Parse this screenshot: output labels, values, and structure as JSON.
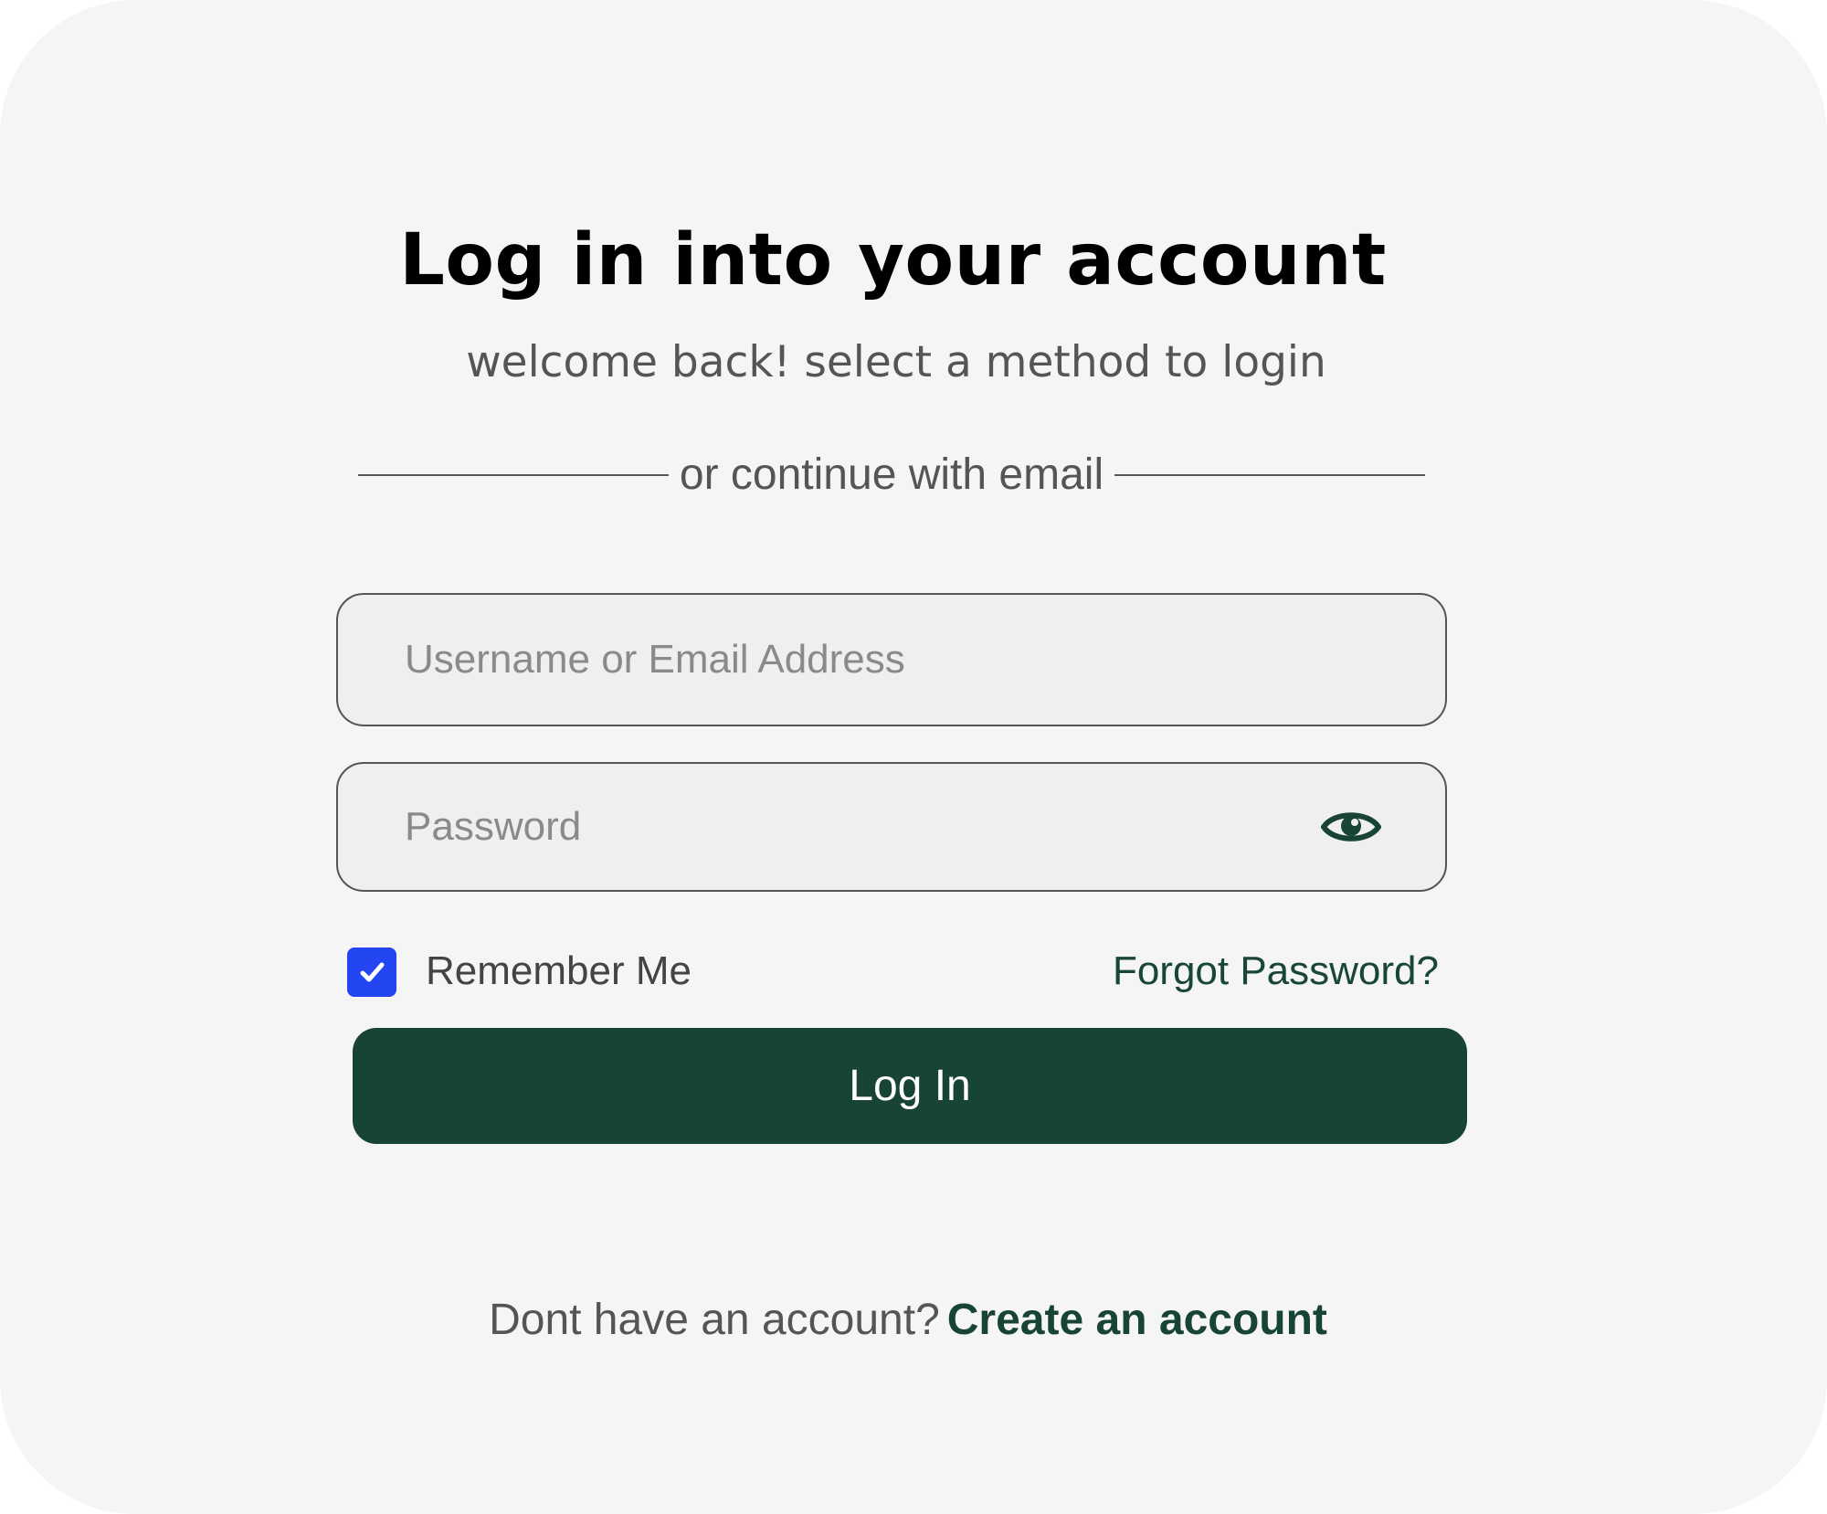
{
  "header": {
    "title": "Log in into your account",
    "subtitle": "welcome back! select a method to login"
  },
  "divider": {
    "text": "or continue with email"
  },
  "form": {
    "username": {
      "value": "",
      "placeholder": "Username or Email Address"
    },
    "password": {
      "value": "",
      "placeholder": "Password",
      "toggle_icon": "eye-icon"
    },
    "remember": {
      "label": "Remember Me",
      "checked": true
    },
    "forgot_label": "Forgot Password?",
    "submit_label": "Log In"
  },
  "footer": {
    "prompt": "Dont have an account?",
    "link_label": "Create an account"
  },
  "colors": {
    "background": "#f5f5f5",
    "primary": "#174433",
    "checkbox": "#2346f2",
    "text_muted": "#555555"
  }
}
